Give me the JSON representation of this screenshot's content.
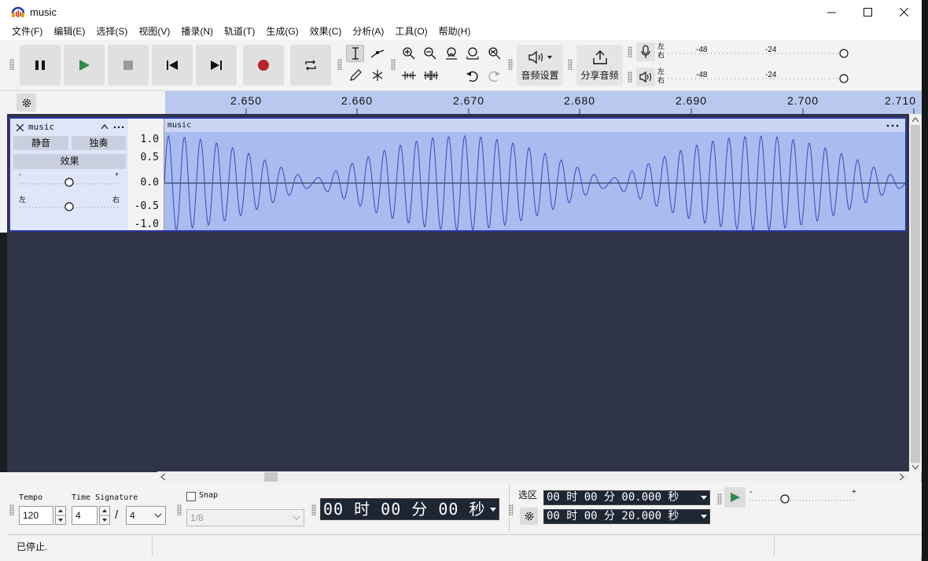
{
  "window": {
    "title": "music"
  },
  "menu": [
    "文件(F)",
    "编辑(E)",
    "选择(S)",
    "视图(V)",
    "播录(N)",
    "轨道(T)",
    "生成(G)",
    "效果(C)",
    "分析(A)",
    "工具(O)",
    "帮助(H)"
  ],
  "toolbar": {
    "audio_setup": "音频设置",
    "share_audio": "分享音频",
    "meter_record": {
      "left": "左",
      "right": "右",
      "ticks": [
        "-48",
        "-24"
      ]
    },
    "meter_play": {
      "left": "左",
      "right": "右",
      "ticks": [
        "-48",
        "-24"
      ]
    }
  },
  "ruler": {
    "labels": [
      "2.650",
      "2.660",
      "2.670",
      "2.680",
      "2.690",
      "2.700",
      "2.710"
    ]
  },
  "track": {
    "name": "music",
    "mute": "静音",
    "solo": "独奏",
    "effects": "效果",
    "gain_minus": "-",
    "gain_plus": "+",
    "pan_left": "左",
    "pan_right": "右",
    "clip_name": "music",
    "scale": [
      "1.0",
      "0.5",
      "0.0",
      "-0.5",
      "-1.0"
    ]
  },
  "bottom": {
    "tempo_label": "Tempo",
    "tempo_value": "120",
    "timesig_label": "Time Signature",
    "timesig_num": "4",
    "timesig_sep": "/",
    "timesig_den": "4",
    "snap_label": "Snap",
    "snap_value": "1/8",
    "time_display": "00 时 00 分 00 秒",
    "selection_label": "选区",
    "sel_start": "00 时 00 分 00.000 秒",
    "sel_end": "00 时 00 分 20.000 秒",
    "speed_minus": "-",
    "speed_plus": "+"
  },
  "status": {
    "text": "已停止."
  }
}
